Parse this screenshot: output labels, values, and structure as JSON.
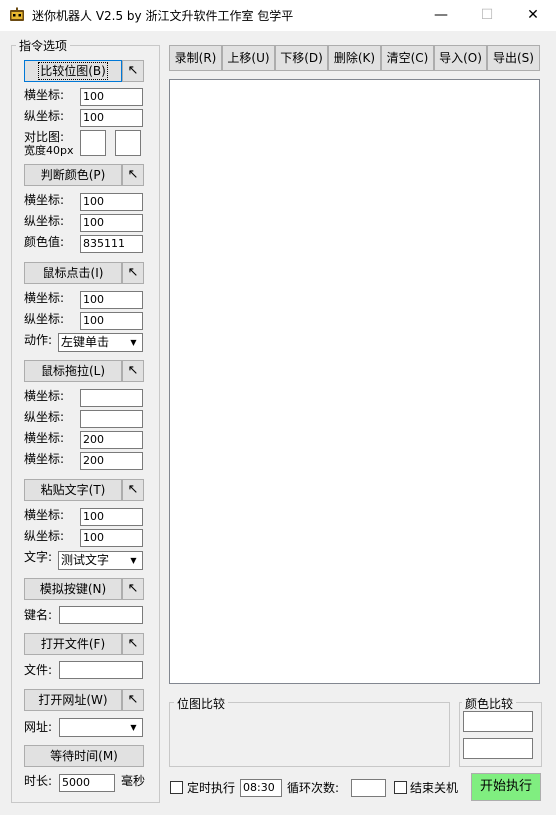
{
  "window": {
    "title": "迷你机器人 V2.5 by 浙江文升软件工作室 包学平",
    "minimize": "—",
    "maximize": "☐",
    "close": "✕"
  },
  "panel": {
    "title": "指令选项"
  },
  "bitmap": {
    "button": "比较位图(B)",
    "x_label": "横坐标:",
    "x_value": "100",
    "y_label": "纵坐标:",
    "y_value": "100",
    "compare_label_1": "对比图:",
    "compare_label_2": "宽度40px"
  },
  "color": {
    "button": "判断颜色(P)",
    "x_label": "横坐标:",
    "x_value": "100",
    "y_label": "纵坐标:",
    "y_value": "100",
    "value_label": "颜色值:",
    "value": "835111"
  },
  "click": {
    "button": "鼠标点击(I)",
    "x_label": "横坐标:",
    "x_value": "100",
    "y_label": "纵坐标:",
    "y_value": "100",
    "action_label": "动作:",
    "action_value": "左键单击"
  },
  "drag": {
    "button": "鼠标拖拉(L)",
    "x1_label": "横坐标:",
    "x1_value": "",
    "y1_label": "纵坐标:",
    "y1_value": "",
    "x2_label": "横坐标:",
    "x2_value": "200",
    "y2_label": "横坐标:",
    "y2_value": "200"
  },
  "paste": {
    "button": "粘贴文字(T)",
    "x_label": "横坐标:",
    "x_value": "100",
    "y_label": "纵坐标:",
    "y_value": "100",
    "text_label": "文字:",
    "text_value": "测试文字"
  },
  "key": {
    "button": "模拟按键(N)",
    "name_label": "键名:",
    "name_value": ""
  },
  "file": {
    "button": "打开文件(F)",
    "file_label": "文件:",
    "file_value": ""
  },
  "url": {
    "button": "打开网址(W)",
    "url_label": "网址:",
    "url_value": ""
  },
  "wait": {
    "button": "等待时间(M)",
    "duration_label": "时长:",
    "duration_value": "5000",
    "unit": "毫秒"
  },
  "pick_icon": "↖",
  "toolbar": {
    "record": "录制(R)",
    "up": "上移(U)",
    "down": "下移(D)",
    "delete": "删除(K)",
    "clear": "清空(C)",
    "import": "导入(O)",
    "export": "导出(S)"
  },
  "bitmap_compare": {
    "title": "位图比较"
  },
  "color_compare": {
    "title": "颜色比较"
  },
  "bottom": {
    "timer_label": "定时执行",
    "timer_value": "08:30",
    "loop_label": "循环次数:",
    "loop_value": "",
    "shutdown_label": "结束关机",
    "run_button": "开始执行"
  },
  "colors": {
    "run_button": "#80ee80",
    "background": "#f0f0f0"
  }
}
